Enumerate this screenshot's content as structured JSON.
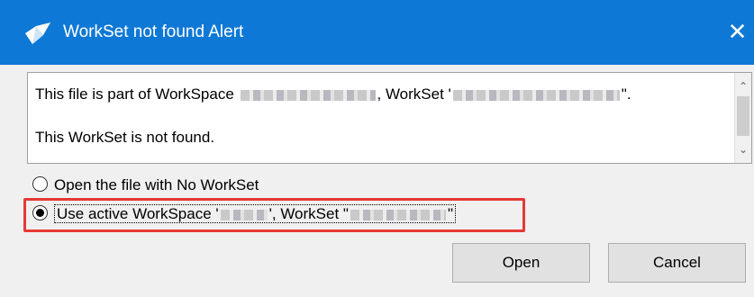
{
  "window": {
    "title": "WorkSet not found Alert",
    "close_glyph": "✕",
    "accent_color": "#0e78d6",
    "app_icon": "check-pencil-icon"
  },
  "message": {
    "line1_prefix": "This file is part of WorkSpace ",
    "line1_mid": ", WorkSet '",
    "line1_suffix": "\".",
    "line2": "This WorkSet is not found."
  },
  "options": {
    "no_workset_label": "Open the file with No WorkSet",
    "active_prefix": "Use active WorkSpace '",
    "active_mid": "', WorkSet \"",
    "active_suffix": "\"",
    "selected": "active"
  },
  "buttons": {
    "open": "Open",
    "cancel": "Cancel"
  },
  "highlight_color": "#e53935"
}
